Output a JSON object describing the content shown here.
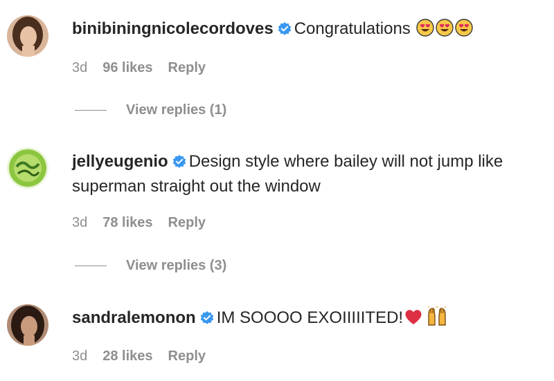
{
  "comments": [
    {
      "username": "binibiningnicolecordoves",
      "text": "Congratulations",
      "emoji_icons": [
        "heart-eyes-emoji-icon",
        "heart-eyes-emoji-icon",
        "heart-eyes-emoji-icon"
      ],
      "time": "3d",
      "likes": "96 likes",
      "reply": "Reply",
      "view_replies": "View replies (1)"
    },
    {
      "username": "jellyeugenio",
      "text_line1": "Design style where bailey will not jump like",
      "text_line2": "superman straight out the window",
      "time": "3d",
      "likes": "78 likes",
      "reply": "Reply",
      "view_replies": "View replies (3)"
    },
    {
      "username": "sandralemonon",
      "text": "IM SOOOO EXOIIIIITED!",
      "emoji_icons": [
        "red-heart-emoji-icon",
        "raising-hands-emoji-icon"
      ],
      "time": "3d",
      "likes": "28 likes",
      "reply": "Reply"
    }
  ],
  "colors": {
    "text": "#262626",
    "muted": "#8e8e8e",
    "verified_badge": "#3897f0"
  }
}
